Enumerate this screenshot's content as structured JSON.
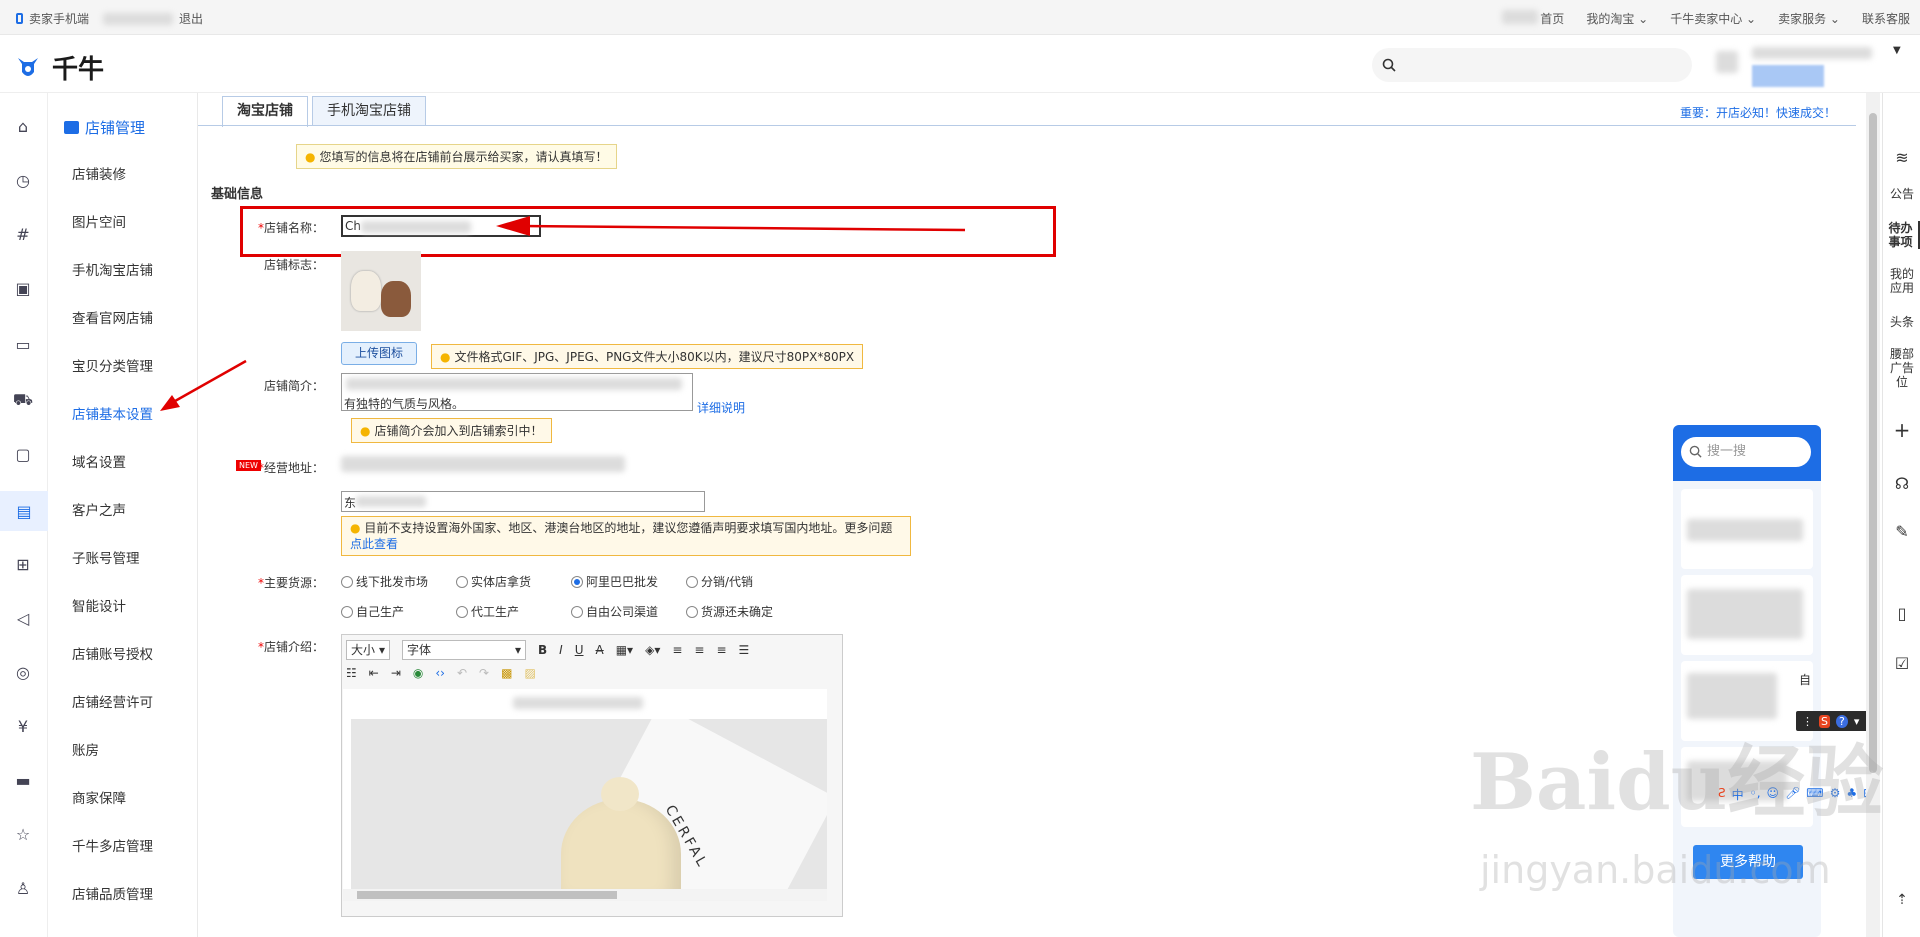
{
  "topbar": {
    "left": "卖家手机端",
    "logout": "退出",
    "links": [
      "首页",
      "我的淘宝",
      "千牛卖家中心",
      "卖家服务",
      "联系客服"
    ]
  },
  "header": {
    "logo_text": "千牛"
  },
  "sidebar": {
    "title": "店铺管理",
    "items": [
      "店铺装修",
      "图片空间",
      "手机淘宝店铺",
      "查看官网店铺",
      "宝贝分类管理",
      "店铺基本设置",
      "域名设置",
      "客户之声",
      "子账号管理",
      "智能设计",
      "店铺账号授权",
      "店铺经营许可",
      "账房",
      "商家保障",
      "千牛多店管理",
      "店铺品质管理"
    ],
    "active": "店铺基本设置"
  },
  "tabs": [
    "淘宝店铺",
    "手机淘宝店铺"
  ],
  "notice": "重要：开店必知！快速成交！",
  "form": {
    "info_hint": "您填写的信息将在店铺前台展示给买家，请认真填写！",
    "section": "基础信息",
    "name_label": "店铺名称：",
    "name_value": "Ch",
    "logo_label": "店铺标志：",
    "upload_btn": "上传图标",
    "upload_hint": "文件格式GIF、JPG、JPEG、PNG文件大小80K以内，建议尺寸80PX*80PX",
    "intro_label": "店铺简介：",
    "intro_partial": "有独特的气质与风格。",
    "intro_link": "详细说明",
    "intro_hint": "店铺简介会加入到店铺索引中！",
    "address_label": "经营地址：",
    "new_badge": "NEW",
    "address_value": "东",
    "address_hint": "目前不支持设置海外国家、地区、港澳台地区的地址，建议您遵循声明要求填写国内地址。更多问题",
    "address_link": "点此查看",
    "source_label": "主要货源：",
    "sources": [
      "线下批发市场",
      "实体店拿货",
      "阿里巴巴批发",
      "分销/代销",
      "自己生产",
      "代工生产",
      "自由公司渠道",
      "货源还未确定"
    ],
    "source_selected": "阿里巴巴批发",
    "desc_label": "店铺介绍：",
    "editor_size": "大小",
    "editor_font": "字体",
    "editor_image_text": "CERFAL"
  },
  "right_rail": [
    "公告",
    "待办事项",
    "我的应用",
    "头条",
    "腰部广告位"
  ],
  "help": {
    "search_placeholder": "搜一搜",
    "more_help": "更多帮助",
    "partial_text": "自"
  },
  "watermark": {
    "line1": "Baidu经验",
    "line2": "jingyan.baidu.com"
  }
}
